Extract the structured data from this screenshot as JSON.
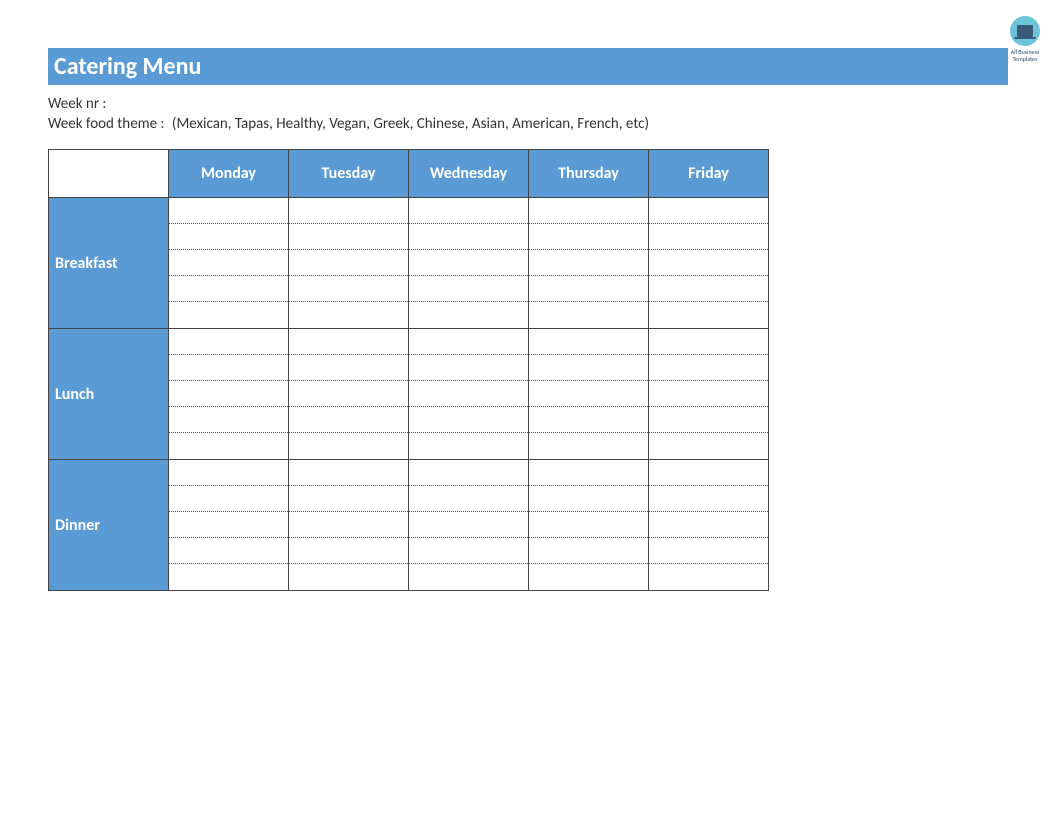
{
  "logo": {
    "line1": "All Business",
    "line2": "Templates"
  },
  "title": "Catering Menu",
  "meta": {
    "week_nr_label": "Week nr :",
    "week_nr_value": "",
    "theme_label": "Week food theme :",
    "theme_hint": "(Mexican, Tapas, Healthy, Vegan, Greek, Chinese, Asian, American, French, etc)"
  },
  "table": {
    "days": [
      "Monday",
      "Tuesday",
      "Wednesday",
      "Thursday",
      "Friday"
    ],
    "meals": [
      {
        "name": "Breakfast",
        "lines": 5
      },
      {
        "name": "Lunch",
        "lines": 5
      },
      {
        "name": "Dinner",
        "lines": 5
      }
    ]
  }
}
